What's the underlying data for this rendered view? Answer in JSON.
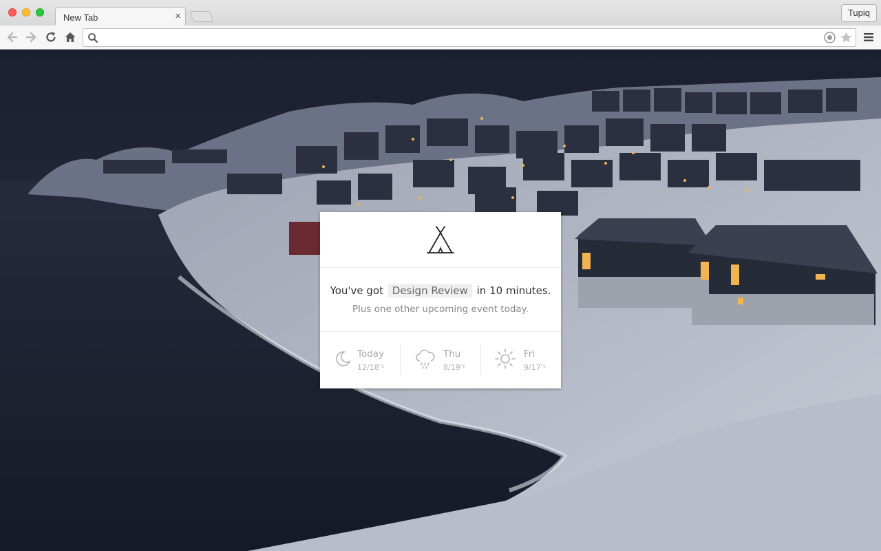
{
  "window": {
    "tab_title": "New Tab",
    "tab_close_glyph": "×",
    "profile_label": "Tupiq"
  },
  "toolbar": {
    "omnibox_value": "",
    "icons": [
      "back-arrow-icon",
      "forward-arrow-icon",
      "reload-icon",
      "home-icon",
      "search-icon",
      "extension-icon",
      "star-icon",
      "menu-icon"
    ]
  },
  "card": {
    "logo": "teepee-icon",
    "event_prefix": "You've got",
    "event_name": "Design Review",
    "event_suffix": "in 10 minutes.",
    "event_sub": "Plus one other upcoming event today.",
    "weather": [
      {
        "day": "Today",
        "low": "12",
        "high": "18",
        "unit": "°c",
        "icon": "moon-icon"
      },
      {
        "day": "Thu",
        "low": "8",
        "high": "19",
        "unit": "°c",
        "icon": "rain-cloud-icon"
      },
      {
        "day": "Fri",
        "low": "9",
        "high": "17",
        "unit": "°c",
        "icon": "sun-icon"
      }
    ]
  },
  "colors": {
    "accent_close": "#fc5f57",
    "accent_min": "#fdbc2e",
    "accent_max": "#28c840",
    "night_sky": "#1d2232",
    "snow": "#c9ccd6"
  }
}
